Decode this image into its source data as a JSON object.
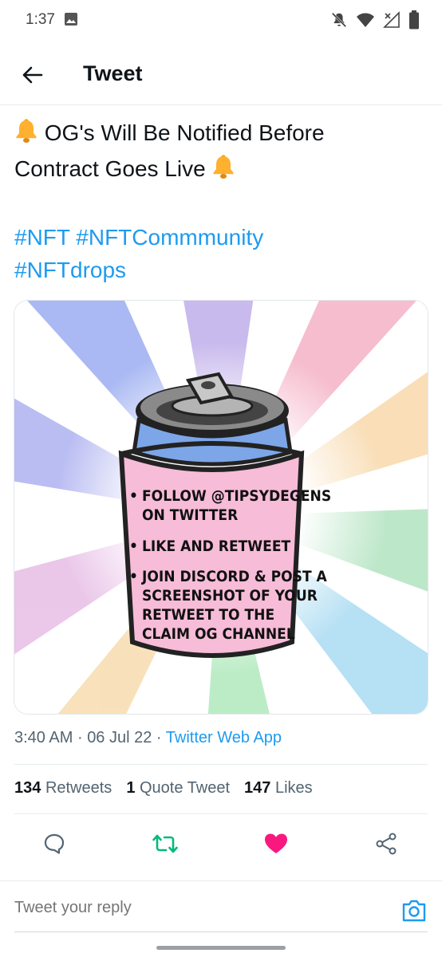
{
  "status_bar": {
    "time": "1:37",
    "icons": [
      "image-icon",
      "bell-off-icon",
      "wifi-icon",
      "no-signal-icon",
      "battery-icon"
    ]
  },
  "header": {
    "title": "Tweet",
    "back_icon": "arrow-left-icon"
  },
  "tweet": {
    "line1": "OG's Will Be Notified Before",
    "line2": "Contract Goes Live",
    "hashtags": [
      "#NFT",
      "#NFTCommmunity",
      "#NFTdrops"
    ],
    "emoji": "bell-emoji",
    "media": {
      "items": [
        "FOLLOW @TIPSYDEGENS ON TWITTER",
        "LIKE AND RETWEET",
        "JOIN DISCORD & POST A SCREENSHOT OF YOUR RETWEET TO THE CLAIM OG CHANNEL"
      ],
      "lines": [
        "FOLLOW @TIPSYDEGENS",
        "ON TWITTER",
        "LIKE AND RETWEET",
        "JOIN DISCORD & POST A",
        "SCREENSHOT OF YOUR",
        "RETWEET TO THE",
        "CLAIM OG CHANNEL"
      ]
    },
    "time": "3:40 AM",
    "date": "06 Jul 22",
    "source": "Twitter Web App",
    "separator": "·"
  },
  "stats": {
    "retweets_count": "134",
    "retweets_label": "Retweets",
    "quotes_count": "1",
    "quotes_label": "Quote Tweet",
    "likes_count": "147",
    "likes_label": "Likes"
  },
  "actions": [
    "reply-icon",
    "retweet-icon",
    "like-icon",
    "share-icon"
  ],
  "colors": {
    "accent": "#1d9bf0",
    "retweet": "#00ba7c",
    "like": "#f91880",
    "text": "#0f1419",
    "secondary": "#536471"
  },
  "reply": {
    "placeholder": "Tweet your reply"
  }
}
